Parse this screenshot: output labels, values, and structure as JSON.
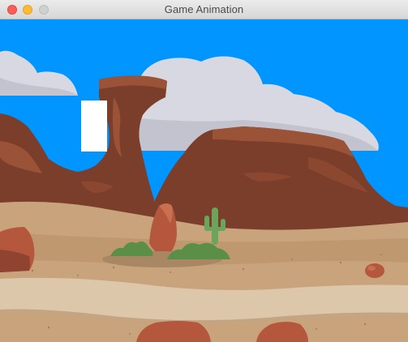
{
  "window": {
    "title": "Game Animation",
    "controls": [
      "close",
      "minimize",
      "zoom"
    ]
  },
  "scene": {
    "theme": "desert",
    "colors": {
      "sky": "#0095ff",
      "cloud": "#d8d8e2",
      "cloud_shadow": "#c3c3cf",
      "mesa": "#7a3e2b",
      "mesa_light": "#9b5338",
      "sand": "#c9a37c",
      "sand_dark": "#b88e64",
      "path": "#dcc7ab",
      "rock": "#b4573d",
      "cactus": "#6ba55c",
      "bush": "#5b8f47",
      "player": "#ffffff"
    }
  }
}
